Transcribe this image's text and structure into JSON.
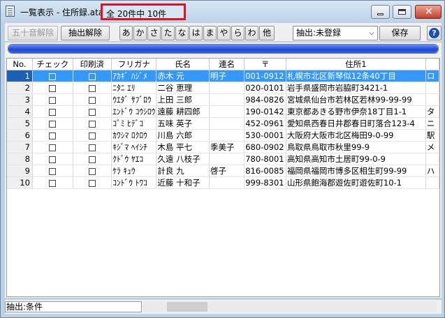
{
  "window": {
    "title": "一覧表示 - 住所録.ata",
    "count": "全 20件中 10件"
  },
  "toolbar": {
    "kana_reset": "五十音解除",
    "extract_reset": "抽出解除",
    "kana": [
      "あ",
      "か",
      "さ",
      "た",
      "な",
      "は",
      "ま",
      "や",
      "ら",
      "わ",
      "他"
    ],
    "filter_value": "抽出:未登録",
    "save": "保存",
    "help": "?"
  },
  "progress": {
    "fraction": 1.0
  },
  "table": {
    "headers": [
      "No.",
      "チェック",
      "印刷済",
      "フリガナ",
      "氏名",
      "連名",
      "〒",
      "住所1",
      ""
    ],
    "rows": [
      {
        "no": "1",
        "furigana": "ｱｶｷﾞ ﾊｼﾞﾒ",
        "name": "赤木 元",
        "renmei": "明子",
        "zip": "001-0912",
        "addr": "札幌市北区新琴似12条40丁目",
        "extra": "ロ"
      },
      {
        "no": "2",
        "furigana": "ﾆﾀﾆ ｴﾘ",
        "name": "二谷 恵理",
        "renmei": "",
        "zip": "020-0101",
        "addr": "岩手県盛岡市岩脇町3421-1",
        "extra": ""
      },
      {
        "no": "3",
        "furigana": "ｳｴﾀﾞ ｻﾌﾞﾛｳ",
        "name": "上田 三郎",
        "renmei": "",
        "zip": "984-0826",
        "addr": "宮城県仙台市若林区若林99-99-99",
        "extra": ""
      },
      {
        "no": "4",
        "furigana": "ｴﾝﾄﾞｳ ｺｳｼﾛｳ",
        "name": "遠藤 耕四郎",
        "renmei": "",
        "zip": "190-0142",
        "addr": "東京都あきる野市伊奈18丁目1-1",
        "extra": "タ"
      },
      {
        "no": "5",
        "furigana": "ｺﾞﾐ ﾋﾃﾞｺ",
        "name": "五味 英子",
        "renmei": "",
        "zip": "452-0961",
        "addr": "愛知県西春日井郡春日町落合123-4",
        "extra": "ニ"
      },
      {
        "no": "6",
        "furigana": "ｶﾜｼﾏ ﾛｸﾛｳ",
        "name": "川島 六郎",
        "renmei": "",
        "zip": "530-0001",
        "addr": "大阪府大阪市北区梅田9-0-99",
        "extra": "駅"
      },
      {
        "no": "7",
        "furigana": "ｷｼﾞﾏ ﾍｲｼﾁ",
        "name": "木島 平七",
        "renmei": "季美子",
        "zip": "680-0902",
        "addr": "鳥取県鳥取市秋里99-9",
        "extra": "メ"
      },
      {
        "no": "8",
        "furigana": "ｸﾄﾞｳ ﾔｴｺ",
        "name": "久遠 八枝子",
        "renmei": "",
        "zip": "780-8001",
        "addr": "高知県高知市土居町99-0-9",
        "extra": ""
      },
      {
        "no": "9",
        "furigana": "ｹﾗ ｷｭｳ",
        "name": "計良 九",
        "renmei": "啓子",
        "zip": "816-0085",
        "addr": "福岡県福岡市博多区相生町99-99",
        "extra": "ハ"
      },
      {
        "no": "10",
        "furigana": "ｺﾝﾄﾞｳ ﾄﾜｺ",
        "name": "近藤 十和子",
        "renmei": "",
        "zip": "999-8301",
        "addr": "山形県飽海郡遊佐町遊佐町10-1",
        "extra": ""
      }
    ]
  },
  "status": {
    "text": "抽出:条件"
  },
  "scroll": {
    "position": 0.08,
    "visible_fraction": 0.14
  }
}
